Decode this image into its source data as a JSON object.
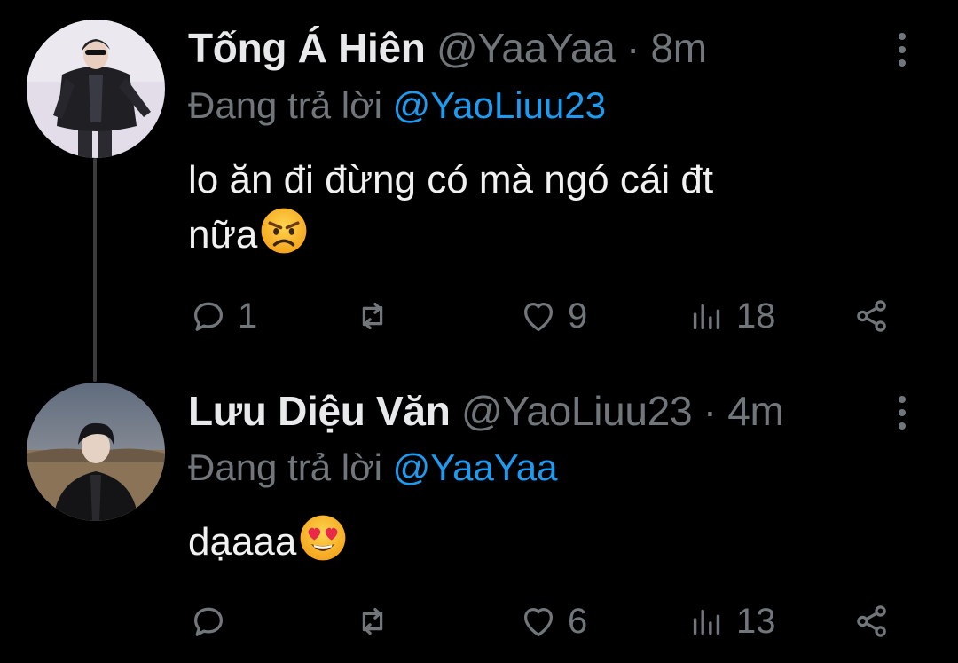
{
  "tweets": [
    {
      "author": {
        "name": "Tống Á Hiên",
        "handle": "@YaaYaa"
      },
      "separator": "·",
      "time": "8m",
      "reply_prefix": "Đang trả lời",
      "reply_to": "@YaoLiuu23",
      "text_line1": "lo ăn đi đừng có mà ngó cái đt",
      "text_line2": "nữa",
      "emoji": "angry-face-emoji",
      "counts": {
        "replies": "1",
        "retweets": "",
        "likes": "9",
        "views": "18"
      }
    },
    {
      "author": {
        "name": "Lưu Diệu Văn",
        "handle": "@YaoLiuu23"
      },
      "separator": "·",
      "time": "4m",
      "reply_prefix": "Đang trả lời",
      "reply_to": "@YaaYaa",
      "text_line1": "dạaaa",
      "emoji": "heart-eyes-emoji",
      "counts": {
        "replies": "",
        "retweets": "",
        "likes": "6",
        "views": "13"
      }
    }
  ],
  "colors": {
    "background": "#000000",
    "muted": "#71767b",
    "mention": "#1d9bf0",
    "thread_line": "#3b3b3b"
  },
  "icons": [
    "reply-icon",
    "retweet-icon",
    "like-icon",
    "views-icon",
    "share-icon",
    "more-icon"
  ]
}
